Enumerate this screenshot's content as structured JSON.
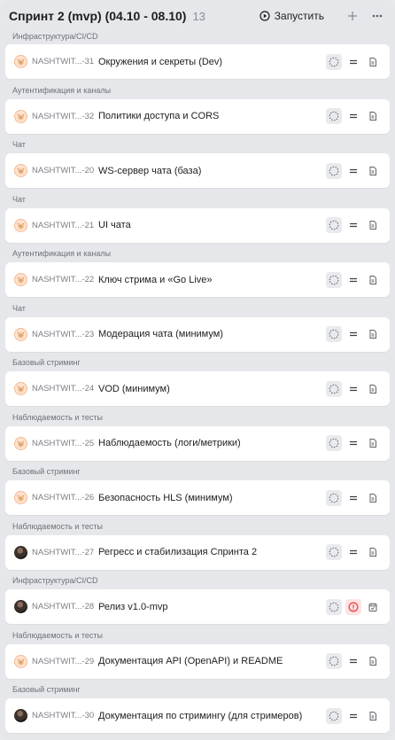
{
  "header": {
    "title": "Спринт 2 (mvp) (04.10 - 08.10)",
    "count": "13",
    "run_label": "Запустить",
    "add_icon": "plus-icon",
    "more_icon": "more-horizontal-icon"
  },
  "colors": {
    "alert": "#e5484d",
    "cat_avatar": "#fde3d2",
    "panel": "#e6e7ea"
  },
  "groups": [
    {
      "label": "Инфраструктура/CI/CD",
      "key": "NASHTWIT...-31",
      "name": "Окружения и секреты (Dev)",
      "avatar": "cat-avatar",
      "alert": false,
      "doc": "document-icon"
    },
    {
      "label": "Аутентификация и каналы",
      "key": "NASHTWIT...-32",
      "name": "Политики доступа и CORS",
      "avatar": "cat-avatar",
      "alert": false,
      "doc": "document-icon"
    },
    {
      "label": "Чат",
      "key": "NASHTWIT...-20",
      "name": "WS-сервер чата (база)",
      "avatar": "cat-avatar",
      "alert": false,
      "doc": "document-icon"
    },
    {
      "label": "Чат",
      "key": "NASHTWIT...-21",
      "name": "UI чата",
      "avatar": "cat-avatar",
      "alert": false,
      "doc": "document-icon"
    },
    {
      "label": "Аутентификация и каналы",
      "key": "NASHTWIT...-22",
      "name": "Ключ стрима и «Go Live»",
      "avatar": "cat-avatar",
      "alert": false,
      "doc": "document-icon"
    },
    {
      "label": "Чат",
      "key": "NASHTWIT...-23",
      "name": "Модерация чата (минимум)",
      "avatar": "cat-avatar",
      "alert": false,
      "doc": "document-icon"
    },
    {
      "label": "Базовый стриминг",
      "key": "NASHTWIT...-24",
      "name": "VOD (минимум)",
      "avatar": "cat-avatar",
      "alert": false,
      "doc": "document-icon"
    },
    {
      "label": "Наблюдаемость и тесты",
      "key": "NASHTWIT...-25",
      "name": "Наблюдаемость (логи/метрики)",
      "avatar": "cat-avatar",
      "alert": false,
      "doc": "document-icon"
    },
    {
      "label": "Базовый стриминг",
      "key": "NASHTWIT...-26",
      "name": "Безопасность HLS (минимум)",
      "avatar": "cat-avatar",
      "alert": false,
      "doc": "document-icon"
    },
    {
      "label": "Наблюдаемость и тесты",
      "key": "NASHTWIT...-27",
      "name": "Регресс и стабилизация Спринта 2",
      "avatar": "photo-avatar",
      "alert": false,
      "doc": "document-icon"
    },
    {
      "label": "Инфраструктура/CI/CD",
      "key": "NASHTWIT...-28",
      "name": "Релиз v1.0-mvp",
      "avatar": "photo-avatar",
      "alert": true,
      "doc": "calendar-check-icon"
    },
    {
      "label": "Наблюдаемость и тесты",
      "key": "NASHTWIT...-29",
      "name": "Документация API (OpenAPI) и README",
      "avatar": "cat-avatar",
      "alert": false,
      "doc": "document-icon"
    },
    {
      "label": "Базовый стриминг",
      "key": "NASHTWIT...-30",
      "name": "Документация по стримингу (для стримеров)",
      "avatar": "photo-avatar",
      "alert": false,
      "doc": "document-icon"
    }
  ]
}
